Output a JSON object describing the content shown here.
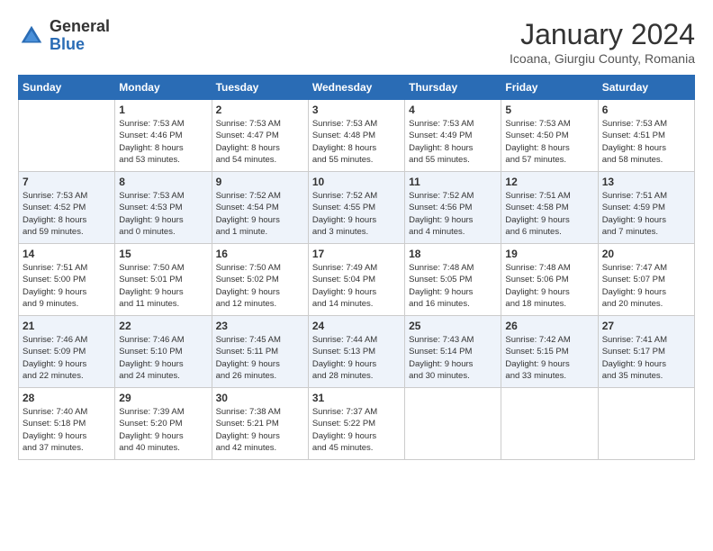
{
  "logo": {
    "general": "General",
    "blue": "Blue"
  },
  "title": "January 2024",
  "location": "Icoana, Giurgiu County, Romania",
  "days_of_week": [
    "Sunday",
    "Monday",
    "Tuesday",
    "Wednesday",
    "Thursday",
    "Friday",
    "Saturday"
  ],
  "weeks": [
    [
      {
        "day": "",
        "info": ""
      },
      {
        "day": "1",
        "info": "Sunrise: 7:53 AM\nSunset: 4:46 PM\nDaylight: 8 hours\nand 53 minutes."
      },
      {
        "day": "2",
        "info": "Sunrise: 7:53 AM\nSunset: 4:47 PM\nDaylight: 8 hours\nand 54 minutes."
      },
      {
        "day": "3",
        "info": "Sunrise: 7:53 AM\nSunset: 4:48 PM\nDaylight: 8 hours\nand 55 minutes."
      },
      {
        "day": "4",
        "info": "Sunrise: 7:53 AM\nSunset: 4:49 PM\nDaylight: 8 hours\nand 55 minutes."
      },
      {
        "day": "5",
        "info": "Sunrise: 7:53 AM\nSunset: 4:50 PM\nDaylight: 8 hours\nand 57 minutes."
      },
      {
        "day": "6",
        "info": "Sunrise: 7:53 AM\nSunset: 4:51 PM\nDaylight: 8 hours\nand 58 minutes."
      }
    ],
    [
      {
        "day": "7",
        "info": "Sunrise: 7:53 AM\nSunset: 4:52 PM\nDaylight: 8 hours\nand 59 minutes."
      },
      {
        "day": "8",
        "info": "Sunrise: 7:53 AM\nSunset: 4:53 PM\nDaylight: 9 hours\nand 0 minutes."
      },
      {
        "day": "9",
        "info": "Sunrise: 7:52 AM\nSunset: 4:54 PM\nDaylight: 9 hours\nand 1 minute."
      },
      {
        "day": "10",
        "info": "Sunrise: 7:52 AM\nSunset: 4:55 PM\nDaylight: 9 hours\nand 3 minutes."
      },
      {
        "day": "11",
        "info": "Sunrise: 7:52 AM\nSunset: 4:56 PM\nDaylight: 9 hours\nand 4 minutes."
      },
      {
        "day": "12",
        "info": "Sunrise: 7:51 AM\nSunset: 4:58 PM\nDaylight: 9 hours\nand 6 minutes."
      },
      {
        "day": "13",
        "info": "Sunrise: 7:51 AM\nSunset: 4:59 PM\nDaylight: 9 hours\nand 7 minutes."
      }
    ],
    [
      {
        "day": "14",
        "info": "Sunrise: 7:51 AM\nSunset: 5:00 PM\nDaylight: 9 hours\nand 9 minutes."
      },
      {
        "day": "15",
        "info": "Sunrise: 7:50 AM\nSunset: 5:01 PM\nDaylight: 9 hours\nand 11 minutes."
      },
      {
        "day": "16",
        "info": "Sunrise: 7:50 AM\nSunset: 5:02 PM\nDaylight: 9 hours\nand 12 minutes."
      },
      {
        "day": "17",
        "info": "Sunrise: 7:49 AM\nSunset: 5:04 PM\nDaylight: 9 hours\nand 14 minutes."
      },
      {
        "day": "18",
        "info": "Sunrise: 7:48 AM\nSunset: 5:05 PM\nDaylight: 9 hours\nand 16 minutes."
      },
      {
        "day": "19",
        "info": "Sunrise: 7:48 AM\nSunset: 5:06 PM\nDaylight: 9 hours\nand 18 minutes."
      },
      {
        "day": "20",
        "info": "Sunrise: 7:47 AM\nSunset: 5:07 PM\nDaylight: 9 hours\nand 20 minutes."
      }
    ],
    [
      {
        "day": "21",
        "info": "Sunrise: 7:46 AM\nSunset: 5:09 PM\nDaylight: 9 hours\nand 22 minutes."
      },
      {
        "day": "22",
        "info": "Sunrise: 7:46 AM\nSunset: 5:10 PM\nDaylight: 9 hours\nand 24 minutes."
      },
      {
        "day": "23",
        "info": "Sunrise: 7:45 AM\nSunset: 5:11 PM\nDaylight: 9 hours\nand 26 minutes."
      },
      {
        "day": "24",
        "info": "Sunrise: 7:44 AM\nSunset: 5:13 PM\nDaylight: 9 hours\nand 28 minutes."
      },
      {
        "day": "25",
        "info": "Sunrise: 7:43 AM\nSunset: 5:14 PM\nDaylight: 9 hours\nand 30 minutes."
      },
      {
        "day": "26",
        "info": "Sunrise: 7:42 AM\nSunset: 5:15 PM\nDaylight: 9 hours\nand 33 minutes."
      },
      {
        "day": "27",
        "info": "Sunrise: 7:41 AM\nSunset: 5:17 PM\nDaylight: 9 hours\nand 35 minutes."
      }
    ],
    [
      {
        "day": "28",
        "info": "Sunrise: 7:40 AM\nSunset: 5:18 PM\nDaylight: 9 hours\nand 37 minutes."
      },
      {
        "day": "29",
        "info": "Sunrise: 7:39 AM\nSunset: 5:20 PM\nDaylight: 9 hours\nand 40 minutes."
      },
      {
        "day": "30",
        "info": "Sunrise: 7:38 AM\nSunset: 5:21 PM\nDaylight: 9 hours\nand 42 minutes."
      },
      {
        "day": "31",
        "info": "Sunrise: 7:37 AM\nSunset: 5:22 PM\nDaylight: 9 hours\nand 45 minutes."
      },
      {
        "day": "",
        "info": ""
      },
      {
        "day": "",
        "info": ""
      },
      {
        "day": "",
        "info": ""
      }
    ]
  ]
}
